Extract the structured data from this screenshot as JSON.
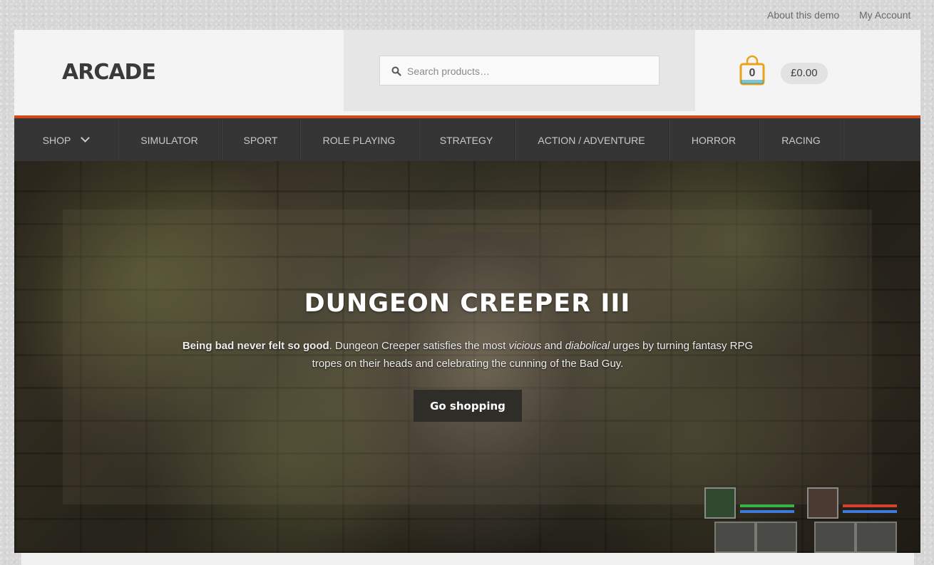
{
  "topbar": {
    "about": "About this demo",
    "account": "My Account"
  },
  "header": {
    "logo": "ARCADE",
    "search_placeholder": "Search products…",
    "cart_count": "0",
    "cart_total": "£0.00"
  },
  "nav": {
    "items": [
      {
        "label": "SHOP"
      },
      {
        "label": "SIMULATOR"
      },
      {
        "label": "SPORT"
      },
      {
        "label": "ROLE PLAYING"
      },
      {
        "label": "STRATEGY"
      },
      {
        "label": "ACTION / ADVENTURE"
      },
      {
        "label": "HORROR"
      },
      {
        "label": "RACING"
      }
    ]
  },
  "hero": {
    "title": "DUNGEON CREEPER III",
    "text_bold": "Being bad never felt so good",
    "text_1": ". Dungeon Creeper satisfies the most ",
    "text_vicious": "vicious",
    "text_and": " and ",
    "text_diabolical": "diabolical",
    "text_2": " urges by turning fantasy RPG tropes on their heads and celebrating the cunning of the Bad Guy.",
    "button": "Go shopping"
  },
  "colors": {
    "accent": "#cf4a1a",
    "nav_bg": "#353535",
    "cart_icon": "#e8a31a",
    "cart_icon_dark": "#1f9bbd"
  }
}
